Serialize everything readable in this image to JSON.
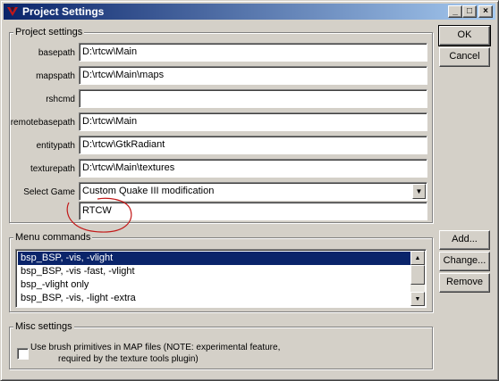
{
  "window": {
    "title": "Project Settings",
    "minimize_glyph": "_",
    "maximize_glyph": "□",
    "close_glyph": "×"
  },
  "buttons": {
    "ok": "OK",
    "cancel": "Cancel",
    "add": "Add...",
    "change": "Change...",
    "remove": "Remove"
  },
  "project_settings": {
    "label": "Project settings",
    "fields": {
      "basepath": {
        "label": "basepath",
        "value": "D:\\rtcw\\Main"
      },
      "mapspath": {
        "label": "mapspath",
        "value": "D:\\rtcw\\Main\\maps"
      },
      "rshcmd": {
        "label": "rshcmd",
        "value": ""
      },
      "remotebasepath": {
        "label": "remotebasepath",
        "value": "D:\\rtcw\\Main"
      },
      "entitypath": {
        "label": "entitypath",
        "value": "D:\\rtcw\\GtkRadiant"
      },
      "texturepath": {
        "label": "texturepath",
        "value": "D:\\rtcw\\Main\\textures"
      }
    },
    "select_game": {
      "label": "Select Game",
      "value": "Custom Quake III modification"
    },
    "custom_game": {
      "value": "RTCW"
    }
  },
  "menu_commands": {
    "label": "Menu commands",
    "items": [
      "bsp_BSP, -vis, -vlight",
      "bsp_BSP, -vis -fast, -vlight",
      "bsp_-vlight only",
      "bsp_BSP, -vis, -light -extra"
    ],
    "selected_index": 0
  },
  "misc_settings": {
    "label": "Misc settings",
    "checkbox_line1": "Use brush primitives in MAP files (NOTE: experimental feature,",
    "checkbox_line2": "required by the texture tools plugin)",
    "checked": false
  },
  "icons": {
    "app": "radiant-app-icon",
    "combo": "chevron-down-icon",
    "scroll_up": "scroll-up-icon",
    "scroll_down": "scroll-down-icon"
  },
  "colors": {
    "titlebar_start": "#0a246a",
    "titlebar_end": "#a6caf0",
    "selection": "#0a246a",
    "annotation": "#c21818"
  }
}
